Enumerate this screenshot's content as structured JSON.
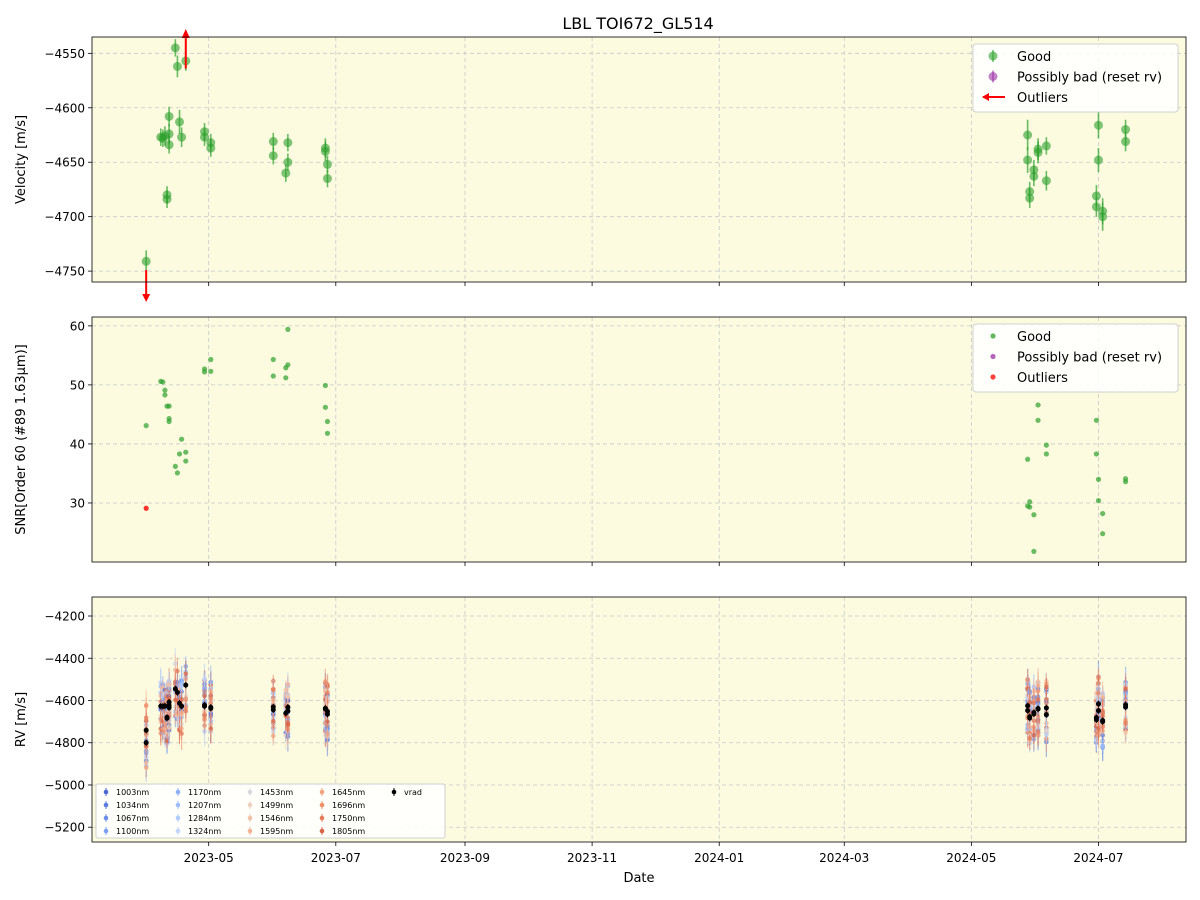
{
  "figure_title": "LBL TOI672_GL514",
  "colors": {
    "panel_bg": "#fcfbe0",
    "good": "#2ca02c",
    "possibly_bad": "#9b30a6",
    "outlier": "#ff0000",
    "vrad": "#000000",
    "grid": "#c8c8c8"
  },
  "chart_data": [
    {
      "type": "scatter",
      "panel": "velocity",
      "ylabel": "Velocity [m/s]",
      "ylim": [
        -4760,
        -4535
      ],
      "yticks": [
        -4750,
        -4700,
        -4650,
        -4600,
        -4550
      ],
      "ytick_labels": [
        "−4750",
        "−4700",
        "−4650",
        "−4600",
        "−4550"
      ],
      "grid": true,
      "legend": {
        "placement": "top-right",
        "entries": [
          {
            "label": "Good",
            "marker": "errorbar-dot",
            "color": "#2ca02c"
          },
          {
            "label": "Possibly bad (reset rv)",
            "marker": "errorbar-dot",
            "color": "#9b30a6"
          },
          {
            "label": "Outliers",
            "marker": "arrow",
            "color": "#ff0000"
          }
        ]
      },
      "series": [
        {
          "name": "Good",
          "points": [
            [
              "2023-04-01",
              -4741,
              10
            ],
            [
              "2023-04-08",
              -4627,
              8
            ],
            [
              "2023-04-09",
              -4628,
              8
            ],
            [
              "2023-04-10",
              -4626,
              9
            ],
            [
              "2023-04-11",
              -4680,
              8
            ],
            [
              "2023-04-11",
              -4684,
              8
            ],
            [
              "2023-04-12",
              -4624,
              9
            ],
            [
              "2023-04-12",
              -4634,
              8
            ],
            [
              "2023-04-12",
              -4608,
              9
            ],
            [
              "2023-04-15",
              -4545,
              8
            ],
            [
              "2023-04-16",
              -4562,
              10
            ],
            [
              "2023-04-17",
              -4613,
              11
            ],
            [
              "2023-04-18",
              -4627,
              9
            ],
            [
              "2023-04-20",
              -4557,
              9
            ],
            [
              "2023-04-29",
              -4622,
              8
            ],
            [
              "2023-04-29",
              -4627,
              8
            ],
            [
              "2023-05-02",
              -4632,
              8
            ],
            [
              "2023-05-02",
              -4637,
              8
            ],
            [
              "2023-06-01",
              -4631,
              8
            ],
            [
              "2023-06-01",
              -4644,
              8
            ],
            [
              "2023-06-07",
              -4660,
              8
            ],
            [
              "2023-06-08",
              -4650,
              8
            ],
            [
              "2023-06-08",
              -4632,
              8
            ],
            [
              "2023-06-26",
              -4640,
              9
            ],
            [
              "2023-06-26",
              -4637,
              9
            ],
            [
              "2023-06-27",
              -4652,
              8
            ],
            [
              "2023-06-27",
              -4665,
              8
            ],
            [
              "2024-05-28",
              -4625,
              14
            ],
            [
              "2024-05-28",
              -4648,
              12
            ],
            [
              "2024-05-29",
              -4677,
              9
            ],
            [
              "2024-05-29",
              -4683,
              9
            ],
            [
              "2024-05-31",
              -4657,
              9
            ],
            [
              "2024-05-31",
              -4663,
              9
            ],
            [
              "2024-06-02",
              -4641,
              10
            ],
            [
              "2024-06-02",
              -4638,
              10
            ],
            [
              "2024-06-06",
              -4667,
              9
            ],
            [
              "2024-06-06",
              -4635,
              8
            ],
            [
              "2024-06-30",
              -4681,
              10
            ],
            [
              "2024-06-30",
              -4691,
              9
            ],
            [
              "2024-07-01",
              -4616,
              12
            ],
            [
              "2024-07-01",
              -4648,
              11
            ],
            [
              "2024-07-03",
              -4695,
              12
            ],
            [
              "2024-07-03",
              -4700,
              13
            ],
            [
              "2024-07-14",
              -4620,
              9
            ],
            [
              "2024-07-14",
              -4631,
              9
            ]
          ]
        },
        {
          "name": "Outliers",
          "points": [
            [
              "2023-04-01",
              -4751,
              "down"
            ],
            [
              "2023-04-20",
              -4553,
              "up"
            ]
          ]
        }
      ]
    },
    {
      "type": "scatter",
      "panel": "snr",
      "ylabel": "SNR[Order 60 (#89 1.63μm)]",
      "ylim": [
        20,
        61.5
      ],
      "yticks": [
        30,
        40,
        50,
        60
      ],
      "ytick_labels": [
        "30",
        "40",
        "50",
        "60"
      ],
      "grid": true,
      "legend": {
        "placement": "top-right",
        "entries": [
          {
            "label": "Good",
            "marker": "dot",
            "color": "#2ca02c"
          },
          {
            "label": "Possibly bad (reset rv)",
            "marker": "dot",
            "color": "#9b30a6"
          },
          {
            "label": "Outliers",
            "marker": "dot",
            "color": "#ff0000"
          }
        ]
      },
      "series": [
        {
          "name": "Good",
          "points": [
            [
              "2023-04-01",
              43.1
            ],
            [
              "2023-04-08",
              50.6
            ],
            [
              "2023-04-09",
              50.5
            ],
            [
              "2023-04-10",
              49.1
            ],
            [
              "2023-04-10",
              48.3
            ],
            [
              "2023-04-11",
              46.4
            ],
            [
              "2023-04-12",
              46.4
            ],
            [
              "2023-04-12",
              44.3
            ],
            [
              "2023-04-12",
              43.8
            ],
            [
              "2023-04-15",
              36.2
            ],
            [
              "2023-04-16",
              35.1
            ],
            [
              "2023-04-17",
              38.3
            ],
            [
              "2023-04-18",
              40.8
            ],
            [
              "2023-04-20",
              38.6
            ],
            [
              "2023-04-20",
              37.1
            ],
            [
              "2023-04-29",
              52.7
            ],
            [
              "2023-04-29",
              52.2
            ],
            [
              "2023-05-02",
              54.3
            ],
            [
              "2023-05-02",
              52.3
            ],
            [
              "2023-06-01",
              54.3
            ],
            [
              "2023-06-01",
              51.5
            ],
            [
              "2023-06-07",
              51.2
            ],
            [
              "2023-06-07",
              52.9
            ],
            [
              "2023-06-08",
              53.4
            ],
            [
              "2023-06-08",
              59.4
            ],
            [
              "2023-06-26",
              49.9
            ],
            [
              "2023-06-26",
              46.2
            ],
            [
              "2023-06-27",
              43.8
            ],
            [
              "2023-06-27",
              41.8
            ],
            [
              "2024-05-28",
              37.4
            ],
            [
              "2024-05-28",
              29.5
            ],
            [
              "2024-05-29",
              29.3
            ],
            [
              "2024-05-29",
              30.2
            ],
            [
              "2024-05-31",
              28.0
            ],
            [
              "2024-05-31",
              21.8
            ],
            [
              "2024-06-02",
              46.6
            ],
            [
              "2024-06-02",
              44.0
            ],
            [
              "2024-06-06",
              39.8
            ],
            [
              "2024-06-06",
              38.3
            ],
            [
              "2024-06-30",
              44.0
            ],
            [
              "2024-06-30",
              38.3
            ],
            [
              "2024-07-01",
              34.0
            ],
            [
              "2024-07-01",
              30.4
            ],
            [
              "2024-07-03",
              28.2
            ],
            [
              "2024-07-03",
              24.8
            ],
            [
              "2024-07-14",
              34.1
            ],
            [
              "2024-07-14",
              33.6
            ]
          ]
        },
        {
          "name": "Outliers",
          "points": [
            [
              "2023-04-01",
              29.1
            ]
          ]
        }
      ]
    },
    {
      "type": "scatter",
      "panel": "rv",
      "ylabel": "RV [m/s]",
      "xlabel": "Date",
      "ylim": [
        -5270,
        -4110
      ],
      "yticks": [
        -5200,
        -5000,
        -4800,
        -4600,
        -4400,
        -4200
      ],
      "ytick_labels": [
        "−5200",
        "−5000",
        "−4800",
        "−4600",
        "−4400",
        "−4200"
      ],
      "grid": true,
      "legend": {
        "placement": "bottom-left",
        "columns": 5,
        "entries": [
          {
            "label": "1003nm",
            "color": "#4a67d6"
          },
          {
            "label": "1034nm",
            "color": "#5a7be0"
          },
          {
            "label": "1067nm",
            "color": "#6a8ee9"
          },
          {
            "label": "1100nm",
            "color": "#7b9ff2"
          },
          {
            "label": "1170nm",
            "color": "#8caff7"
          },
          {
            "label": "1207nm",
            "color": "#9dbdfb"
          },
          {
            "label": "1284nm",
            "color": "#b0cafc"
          },
          {
            "label": "1324nm",
            "color": "#c2d5fb"
          },
          {
            "label": "1453nm",
            "color": "#d8d9dc"
          },
          {
            "label": "1499nm",
            "color": "#ecd1c1"
          },
          {
            "label": "1546nm",
            "color": "#f2c2a7"
          },
          {
            "label": "1595nm",
            "color": "#f4b295"
          },
          {
            "label": "1645nm",
            "color": "#f2a27f"
          },
          {
            "label": "1696nm",
            "color": "#ee8f6a"
          },
          {
            "label": "1750nm",
            "color": "#e57b58"
          },
          {
            "label": "1805nm",
            "color": "#d86448"
          },
          {
            "label": "vrad",
            "color": "#000000"
          }
        ]
      },
      "x_ticks": [
        "2023-05",
        "2023-07",
        "2023-09",
        "2023-11",
        "2024-01",
        "2024-03",
        "2024-05",
        "2024-07"
      ],
      "x_range": [
        "2023-03-06",
        "2024-08-12"
      ],
      "series": [
        {
          "name": "vrad",
          "points": [
            [
              "2023-04-01",
              -4741
            ],
            [
              "2023-04-01",
              -4800
            ],
            [
              "2023-04-08",
              -4627
            ],
            [
              "2023-04-09",
              -4628
            ],
            [
              "2023-04-10",
              -4626
            ],
            [
              "2023-04-11",
              -4680
            ],
            [
              "2023-04-11",
              -4684
            ],
            [
              "2023-04-12",
              -4624
            ],
            [
              "2023-04-12",
              -4634
            ],
            [
              "2023-04-12",
              -4608
            ],
            [
              "2023-04-15",
              -4545
            ],
            [
              "2023-04-16",
              -4562
            ],
            [
              "2023-04-17",
              -4613
            ],
            [
              "2023-04-18",
              -4627
            ],
            [
              "2023-04-20",
              -4527
            ],
            [
              "2023-04-29",
              -4622
            ],
            [
              "2023-04-29",
              -4627
            ],
            [
              "2023-05-02",
              -4632
            ],
            [
              "2023-05-02",
              -4637
            ],
            [
              "2023-06-01",
              -4631
            ],
            [
              "2023-06-01",
              -4644
            ],
            [
              "2023-06-07",
              -4660
            ],
            [
              "2023-06-08",
              -4650
            ],
            [
              "2023-06-08",
              -4632
            ],
            [
              "2023-06-26",
              -4640
            ],
            [
              "2023-06-26",
              -4637
            ],
            [
              "2023-06-27",
              -4652
            ],
            [
              "2023-06-27",
              -4665
            ],
            [
              "2024-05-28",
              -4625
            ],
            [
              "2024-05-28",
              -4648
            ],
            [
              "2024-05-29",
              -4677
            ],
            [
              "2024-05-29",
              -4683
            ],
            [
              "2024-05-31",
              -4657
            ],
            [
              "2024-05-31",
              -4663
            ],
            [
              "2024-06-02",
              -4641
            ],
            [
              "2024-06-02",
              -4638
            ],
            [
              "2024-06-06",
              -4667
            ],
            [
              "2024-06-06",
              -4635
            ],
            [
              "2024-06-30",
              -4681
            ],
            [
              "2024-06-30",
              -4691
            ],
            [
              "2024-07-01",
              -4616
            ],
            [
              "2024-07-01",
              -4648
            ],
            [
              "2024-07-03",
              -4695
            ],
            [
              "2024-07-03",
              -4700
            ],
            [
              "2024-07-14",
              -4620
            ],
            [
              "2024-07-14",
              -4631
            ]
          ]
        }
      ]
    }
  ]
}
